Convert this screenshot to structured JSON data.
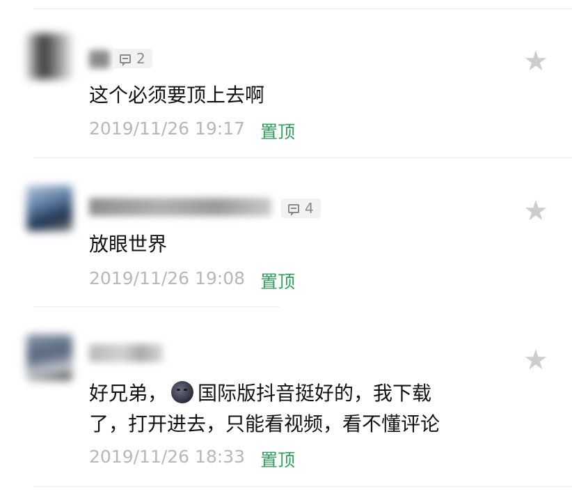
{
  "comments": [
    {
      "reply_count": "2",
      "text": "这个必须要顶上去啊",
      "timestamp": "2019/11/26 19:17",
      "pin_label": "置顶"
    },
    {
      "reply_count": "4",
      "text": "放眼世界",
      "timestamp": "2019/11/26 19:08",
      "pin_label": "置顶"
    },
    {
      "reply_count": "",
      "text_line1_before_emoji": "好兄弟，",
      "text_line1_after_emoji": "国际版抖音挺好的，我下载",
      "text_line2": "了，打开进去，只能看视频，看不懂评论",
      "timestamp": "2019/11/26 18:33",
      "pin_label": "置顶",
      "emoji": "new-moon-face"
    }
  ],
  "icons": {
    "reply": "comment-bubble-icon",
    "star": "star-icon",
    "star_glyph": "★"
  },
  "colors": {
    "pin": "#2f9e5a",
    "timestamp": "#b7b7b7",
    "text": "#111111",
    "star": "#cdcdcd"
  }
}
